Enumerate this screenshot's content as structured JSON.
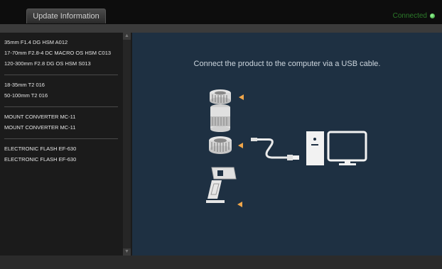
{
  "header": {
    "update_label": "Update Information",
    "status_label": "Connected"
  },
  "sidebar": {
    "groups": [
      {
        "items": [
          "35mm F1.4 DG HSM A012",
          "17-70mm F2.8-4 DC MACRO OS HSM C013",
          "120-300mm F2.8 DG OS HSM S013"
        ]
      },
      {
        "items": [
          "18-35mm T2 016",
          "50-100mm T2 016"
        ]
      },
      {
        "items": [
          "MOUNT CONVERTER MC-11",
          "MOUNT CONVERTER MC-11"
        ]
      },
      {
        "items": [
          "ELECTRONIC FLASH EF-630",
          "ELECTRONIC FLASH EF-630"
        ]
      }
    ]
  },
  "main": {
    "message": "Connect the product to the computer via a USB cable."
  },
  "colors": {
    "accent_arrow": "#f0a64a",
    "status_green": "#2e8b2e",
    "main_bg": "#1e3042"
  }
}
